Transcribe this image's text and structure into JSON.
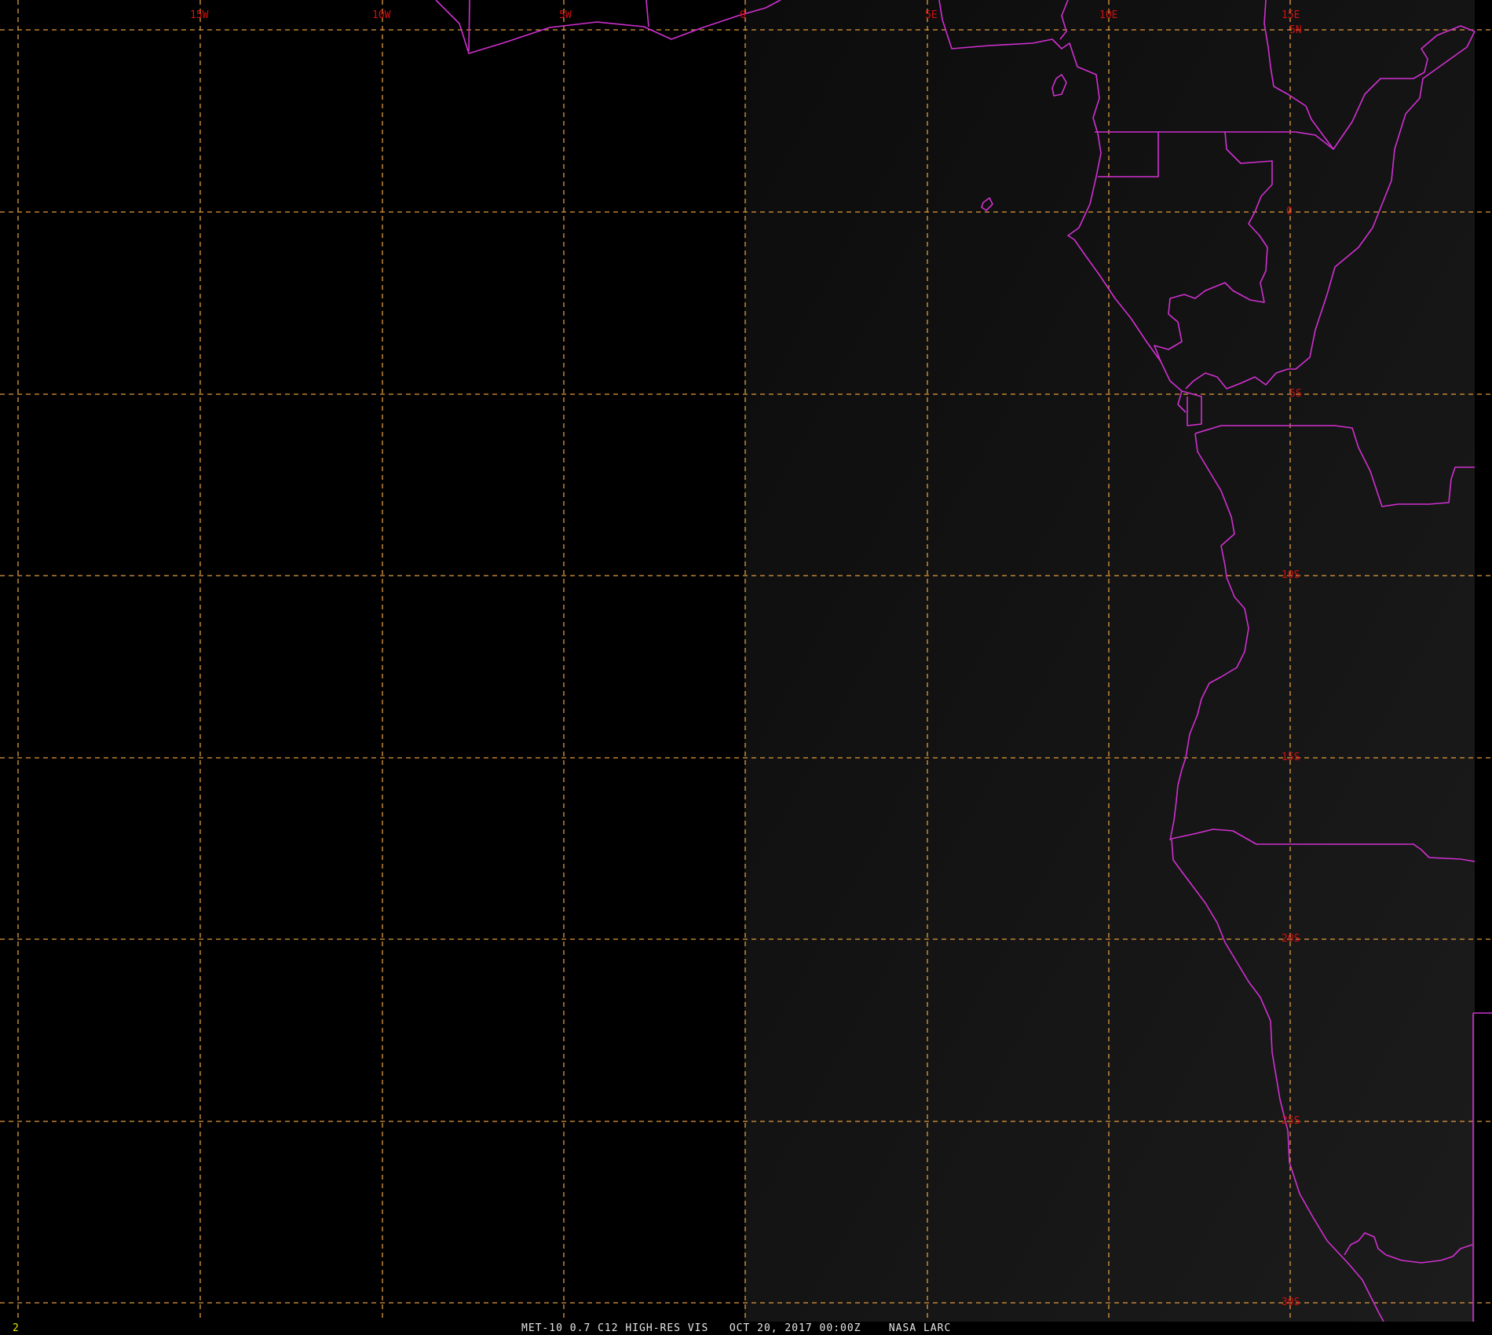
{
  "map": {
    "frame_number": "2",
    "caption": {
      "sensor": "MET-10 0.7 C12 HIGH-RES VIS",
      "datetime": "OCT 20, 2017 00:00Z",
      "credit": "NASA LARC"
    },
    "longitude_labels": [
      "15W",
      "10W",
      "5W",
      "0",
      "5E",
      "10E",
      "15E"
    ],
    "latitude_labels": [
      "5N",
      "0",
      "5S",
      "10S",
      "15S",
      "20S",
      "25S",
      "30S"
    ],
    "colors": {
      "background": "#000000",
      "night_side": "#000000",
      "day_side_gradient": [
        "#0c0c0c",
        "#1a1a1a"
      ],
      "gridline": "#e09a40",
      "grid_label": "#d01010",
      "coastline": "#d030d0",
      "frame_number": "#e8e800",
      "caption_text": "#e6e6e6"
    },
    "features": [
      "coastline",
      "political-borders",
      "lat-lon-grid"
    ]
  }
}
